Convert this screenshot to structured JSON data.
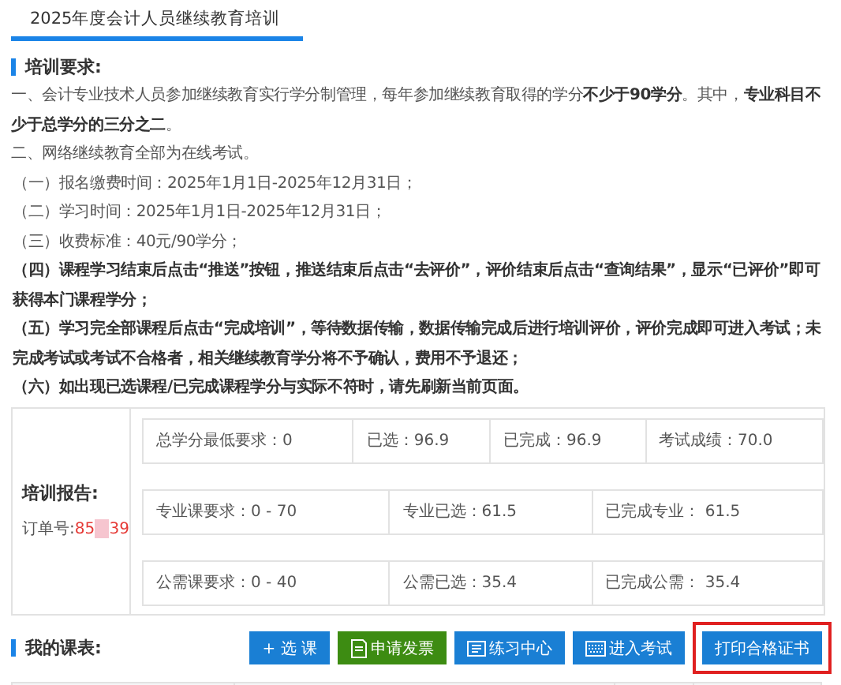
{
  "tab": {
    "label": "2025年度会计人员继续教育培训",
    "selected": true
  },
  "requirements": {
    "heading": "培训要求:",
    "lines": [
      {
        "kind": "clause",
        "text": "一、会计专业技术人员参加继续教育实行学分制管理，每年参加继续教育取得的学分**不少于90学分**。其中，**专业科目不少于总学分的三分之二**。",
        "emphasis": false
      },
      {
        "kind": "clause",
        "text": "二、网络继续教育全部为在线考试。",
        "emphasis": false
      },
      {
        "kind": "item",
        "text": "（一）报名缴费时间：2025年1月1日-2025年12月31日；",
        "emphasis": false
      },
      {
        "kind": "item",
        "text": "（二）学习时间：2025年1月1日-2025年12月31日；",
        "emphasis": false
      },
      {
        "kind": "item",
        "text": "（三）收费标准：40元/90学分；",
        "emphasis": false
      },
      {
        "kind": "item",
        "text": "（四）课程学习结束后点击“推送”按钮，推送结束后点击“去评价”，评价结束后点击“查询结果”，显示“已评价”即可获得本门课程学分；",
        "emphasis": true
      },
      {
        "kind": "item",
        "text": "（五）学习完全部课程后点击“完成培训”，等待数据传输，数据传输完成后进行培训评价，评价完成即可进入考试；未完成考试或考试不合格者，相关继续教育学分将不予确认，费用不予退还；",
        "emphasis": true
      },
      {
        "kind": "item",
        "text": "（六）如出现已选课程/已完成课程学分与实际不符时，请先刷新当前页面。",
        "emphasis": true
      }
    ]
  },
  "report": {
    "heading": "培训报告:",
    "order_label": "订单号:",
    "order_start": "85",
    "order_end": "39",
    "redacted": true,
    "rows": [
      [
        "总学分最低要求：0",
        "已选：96.9",
        "已完成：96.9",
        "考试成绩：70.0"
      ],
      [
        "专业课要求：0 - 70",
        "专业已选：61.5",
        "已完成专业： 61.5"
      ],
      [
        "公需课要求：0 - 40",
        "公需已选：35.4",
        "已完成公需： 35.4"
      ]
    ]
  },
  "schedule": {
    "heading": "我的课表:",
    "buttons": [
      {
        "kind": "add",
        "label": "+ 选 课",
        "color": "#1a7fd4",
        "highlighted": false
      },
      {
        "kind": "invoice",
        "label": "申请发票",
        "color": "#3d8c12",
        "highlighted": false
      },
      {
        "kind": "practice",
        "label": "练习中心",
        "color": "#1a7fd4",
        "highlighted": false
      },
      {
        "kind": "exam",
        "label": "进入考试",
        "color": "#1a7fd4",
        "highlighted": false
      },
      {
        "kind": "print",
        "label": "打印合格证书",
        "color": "#1a7fd4",
        "highlighted": true
      }
    ]
  }
}
